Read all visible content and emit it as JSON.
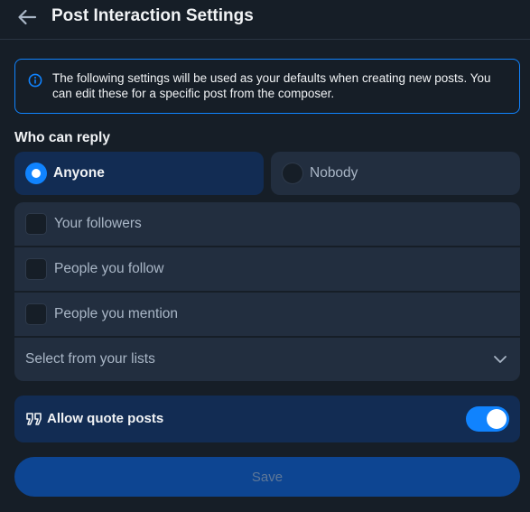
{
  "header": {
    "title": "Post Interaction Settings",
    "back_icon": "arrow-left-icon"
  },
  "info": {
    "icon": "info-circle-icon",
    "text": "The following settings will be used as your defaults when creating new posts. You can edit these for a specific post from the composer."
  },
  "reply": {
    "section_label": "Who can reply",
    "options": [
      {
        "label": "Anyone",
        "selected": true
      },
      {
        "label": "Nobody",
        "selected": false
      }
    ],
    "checkboxes": [
      {
        "label": "Your followers",
        "checked": false
      },
      {
        "label": "People you follow",
        "checked": false
      },
      {
        "label": "People you mention",
        "checked": false
      }
    ],
    "lists_select": {
      "label": "Select from your lists",
      "icon": "chevron-down-icon"
    }
  },
  "quote": {
    "icon": "quote-icon",
    "label": "Allow quote posts",
    "enabled": true
  },
  "save_label": "Save",
  "colors": {
    "background": "#161e27",
    "accent": "#1083fe",
    "selected_bg": "#122c53",
    "row_bg": "#222e3f",
    "save_bg": "#0d4592"
  }
}
